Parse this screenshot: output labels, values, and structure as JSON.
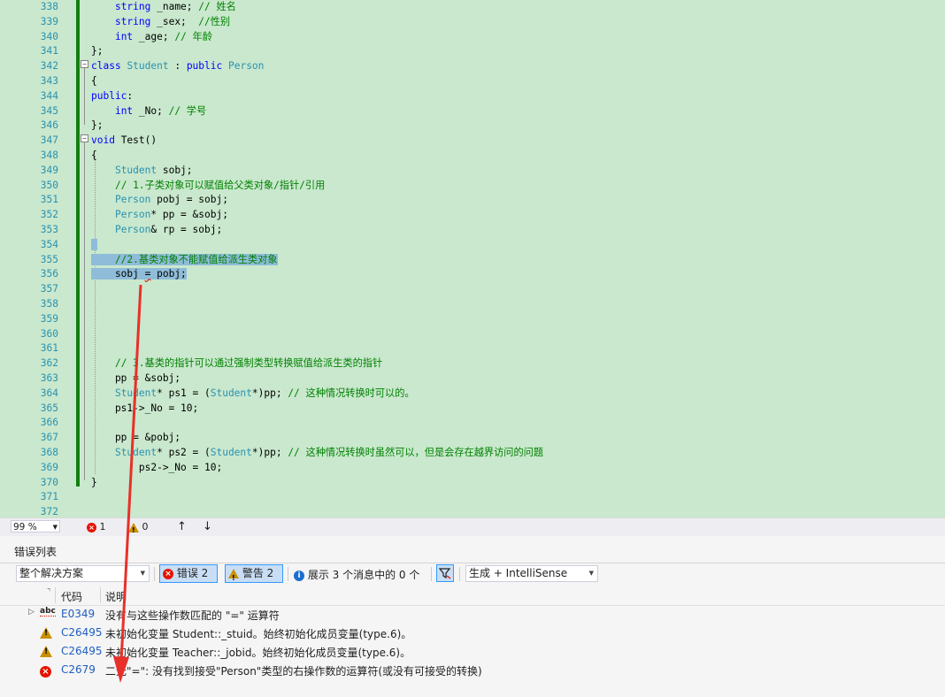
{
  "editor": {
    "lines": [
      {
        "n": "338",
        "tokens": [
          [
            "    ",
            ""
          ],
          [
            "string",
            "kw"
          ],
          [
            " _name; ",
            ""
          ],
          [
            "// 姓名",
            "cm"
          ]
        ]
      },
      {
        "n": "339",
        "tokens": [
          [
            "    ",
            ""
          ],
          [
            "string",
            "kw"
          ],
          [
            " _sex;  ",
            ""
          ],
          [
            "//性别",
            "cm"
          ]
        ]
      },
      {
        "n": "340",
        "tokens": [
          [
            "    ",
            ""
          ],
          [
            "int",
            "kw"
          ],
          [
            " _age; ",
            ""
          ],
          [
            "// 年龄",
            "cm"
          ]
        ]
      },
      {
        "n": "341",
        "tokens": [
          [
            "};",
            ""
          ]
        ]
      },
      {
        "n": "342",
        "tokens": [
          [
            "class",
            "kw"
          ],
          [
            " ",
            ""
          ],
          [
            "Student",
            "ty"
          ],
          [
            " : ",
            ""
          ],
          [
            "public",
            "kw"
          ],
          [
            " ",
            ""
          ],
          [
            "Person",
            "ty"
          ]
        ]
      },
      {
        "n": "343",
        "tokens": [
          [
            "{",
            ""
          ]
        ]
      },
      {
        "n": "344",
        "tokens": [
          [
            "public",
            "kw"
          ],
          [
            ":",
            ""
          ]
        ]
      },
      {
        "n": "345",
        "tokens": [
          [
            "    ",
            ""
          ],
          [
            "int",
            "kw"
          ],
          [
            " _No; ",
            ""
          ],
          [
            "// 学号",
            "cm"
          ]
        ]
      },
      {
        "n": "346",
        "tokens": [
          [
            "};",
            ""
          ]
        ]
      },
      {
        "n": "347",
        "tokens": [
          [
            "void",
            "kw"
          ],
          [
            " Test()",
            ""
          ]
        ]
      },
      {
        "n": "348",
        "tokens": [
          [
            "{",
            ""
          ]
        ]
      },
      {
        "n": "349",
        "tokens": [
          [
            "    ",
            ""
          ],
          [
            "Student",
            "ty"
          ],
          [
            " sobj;",
            ""
          ]
        ]
      },
      {
        "n": "350",
        "tokens": [
          [
            "    ",
            ""
          ],
          [
            "// 1.子类对象可以赋值给父类对象/指针/引用",
            "cm"
          ]
        ]
      },
      {
        "n": "351",
        "tokens": [
          [
            "    ",
            ""
          ],
          [
            "Person",
            "ty"
          ],
          [
            " pobj = sobj;",
            ""
          ]
        ]
      },
      {
        "n": "352",
        "tokens": [
          [
            "    ",
            ""
          ],
          [
            "Person",
            "ty"
          ],
          [
            "* pp = &sobj;",
            ""
          ]
        ]
      },
      {
        "n": "353",
        "tokens": [
          [
            "    ",
            ""
          ],
          [
            "Person",
            "ty"
          ],
          [
            "& rp = sobj;",
            ""
          ]
        ]
      },
      {
        "n": "354",
        "tokens": [
          [
            " ",
            "sel"
          ]
        ]
      },
      {
        "n": "355",
        "tokens": [
          [
            "    //2.基类对象不能赋值给派生类对象",
            "sel cm"
          ]
        ]
      },
      {
        "n": "356",
        "tokens": [
          [
            "    sobj ",
            "sel"
          ],
          [
            "=",
            "sel squig"
          ],
          [
            " pobj;",
            "sel"
          ]
        ]
      },
      {
        "n": "357",
        "tokens": []
      },
      {
        "n": "358",
        "tokens": []
      },
      {
        "n": "359",
        "tokens": []
      },
      {
        "n": "360",
        "tokens": []
      },
      {
        "n": "361",
        "tokens": []
      },
      {
        "n": "362",
        "tokens": [
          [
            "    ",
            ""
          ],
          [
            "// 3.基类的指针可以通过强制类型转换赋值给派生类的指针",
            "cm"
          ]
        ]
      },
      {
        "n": "363",
        "tokens": [
          [
            "    pp = &sobj;",
            ""
          ]
        ]
      },
      {
        "n": "364",
        "tokens": [
          [
            "    ",
            ""
          ],
          [
            "Student",
            "ty"
          ],
          [
            "* ps1 = (",
            ""
          ],
          [
            "Student",
            "ty"
          ],
          [
            "*)pp; ",
            ""
          ],
          [
            "// 这种情况转换时可以的。",
            "cm"
          ]
        ]
      },
      {
        "n": "365",
        "tokens": [
          [
            "    ps1->_No = 10;",
            ""
          ]
        ]
      },
      {
        "n": "366",
        "tokens": []
      },
      {
        "n": "367",
        "tokens": [
          [
            "    pp = &pobj;",
            ""
          ]
        ]
      },
      {
        "n": "368",
        "tokens": [
          [
            "    ",
            ""
          ],
          [
            "Student",
            "ty"
          ],
          [
            "* ps2 = (",
            ""
          ],
          [
            "Student",
            "ty"
          ],
          [
            "*)pp; ",
            ""
          ],
          [
            "// 这种情况转换时虽然可以，但是会存在越界访问的问题",
            "cm"
          ]
        ]
      },
      {
        "n": "369",
        "tokens": [
          [
            "        ps2->_No = 10;",
            ""
          ]
        ]
      },
      {
        "n": "370",
        "tokens": [
          [
            "}",
            ""
          ]
        ]
      },
      {
        "n": "371",
        "tokens": []
      },
      {
        "n": "372",
        "tokens": []
      }
    ]
  },
  "statusbar": {
    "zoom": "99 %",
    "error_count": "1",
    "warning_count": "0",
    "up_glyph": "↑",
    "down_glyph": "↓"
  },
  "error_list": {
    "title": "错误列表",
    "scope": "整个解决方案",
    "errors_button": "错误 2",
    "warnings_button": "警告 2",
    "messages_text": "展示 3 个消息中的 0 个",
    "build_filter": "生成 + IntelliSense",
    "col_code": "代码",
    "col_desc": "说明",
    "rows": [
      {
        "type": "intellisense",
        "code": "E0349",
        "desc": "没有与这些操作数匹配的 \"=\" 运算符"
      },
      {
        "type": "warning",
        "code": "C26495",
        "desc": "未初始化变量 Student::_stuid。始终初始化成员变量(type.6)。"
      },
      {
        "type": "warning",
        "code": "C26495",
        "desc": "未初始化变量 Teacher::_jobid。始终初始化成员变量(type.6)。"
      },
      {
        "type": "error",
        "code": "C2679",
        "desc": "二元\"=\": 没有找到接受\"Person\"类型的右操作数的运算符(或没有可接受的转换)"
      }
    ]
  },
  "colors": {
    "editor_bg": "#c9e8cd",
    "selection": "#8fbcd9",
    "annotation_arrow": "#e8302a"
  }
}
